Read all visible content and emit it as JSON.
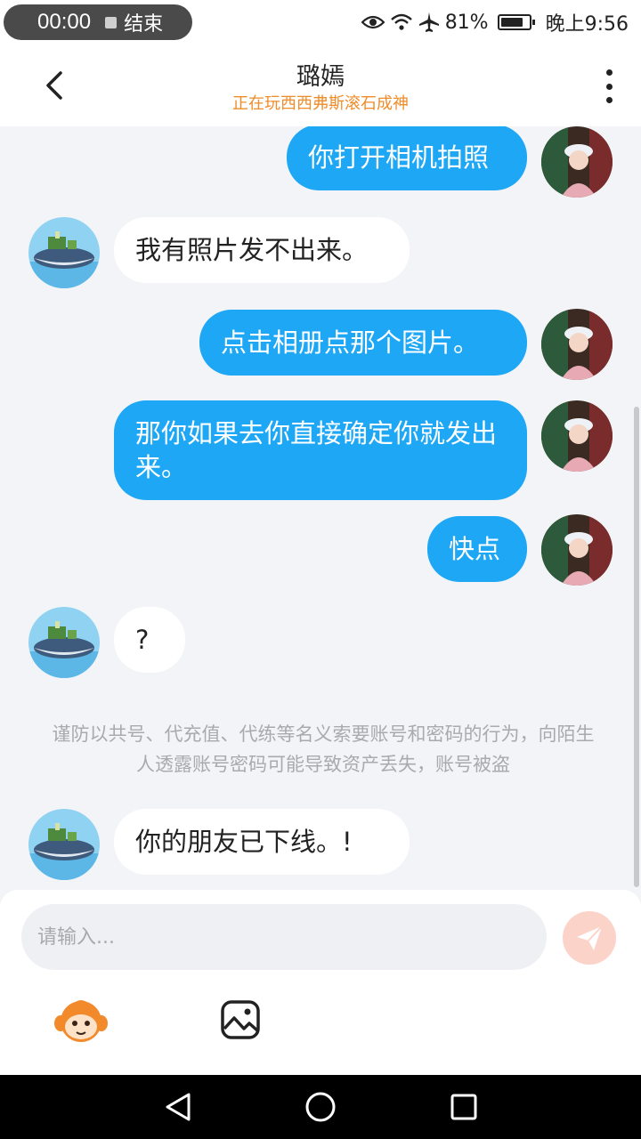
{
  "status_bar": {
    "recording_time": "00:00",
    "recording_stop_label": "结束",
    "battery_percent": "81%",
    "battery_level": 0.81,
    "clock": "晚上9:56",
    "icons": [
      "eye-icon",
      "wifi-icon",
      "airplane-icon",
      "battery-icon"
    ]
  },
  "header": {
    "title": "璐嫣",
    "subtitle": "正在玩西西弗斯滚石成神",
    "subtitle_color": "#f08c2a"
  },
  "messages": [
    {
      "side": "out",
      "text": "你打开相机拍照"
    },
    {
      "side": "in",
      "text": "我有照片发不出来。"
    },
    {
      "side": "out",
      "text": "点击相册点那个图片。"
    },
    {
      "side": "out",
      "text": "那你如果去你直接确定你就发出来。"
    },
    {
      "side": "out",
      "text": "快点"
    },
    {
      "side": "in",
      "text": "?"
    },
    {
      "side": "in",
      "text": "你的朋友已下线。!"
    }
  ],
  "warning": "谨防以共号、代充值、代练等名义索要账号和密码的行为，向陌生人透露账号密码可能导致资产丢失，账号被盗",
  "input": {
    "placeholder": "请输入..."
  },
  "colors": {
    "outgoing_bubble": "#1ea7f5",
    "incoming_bubble": "#ffffff",
    "background": "#f3f4f7",
    "send_button": "#fbd3c9"
  }
}
